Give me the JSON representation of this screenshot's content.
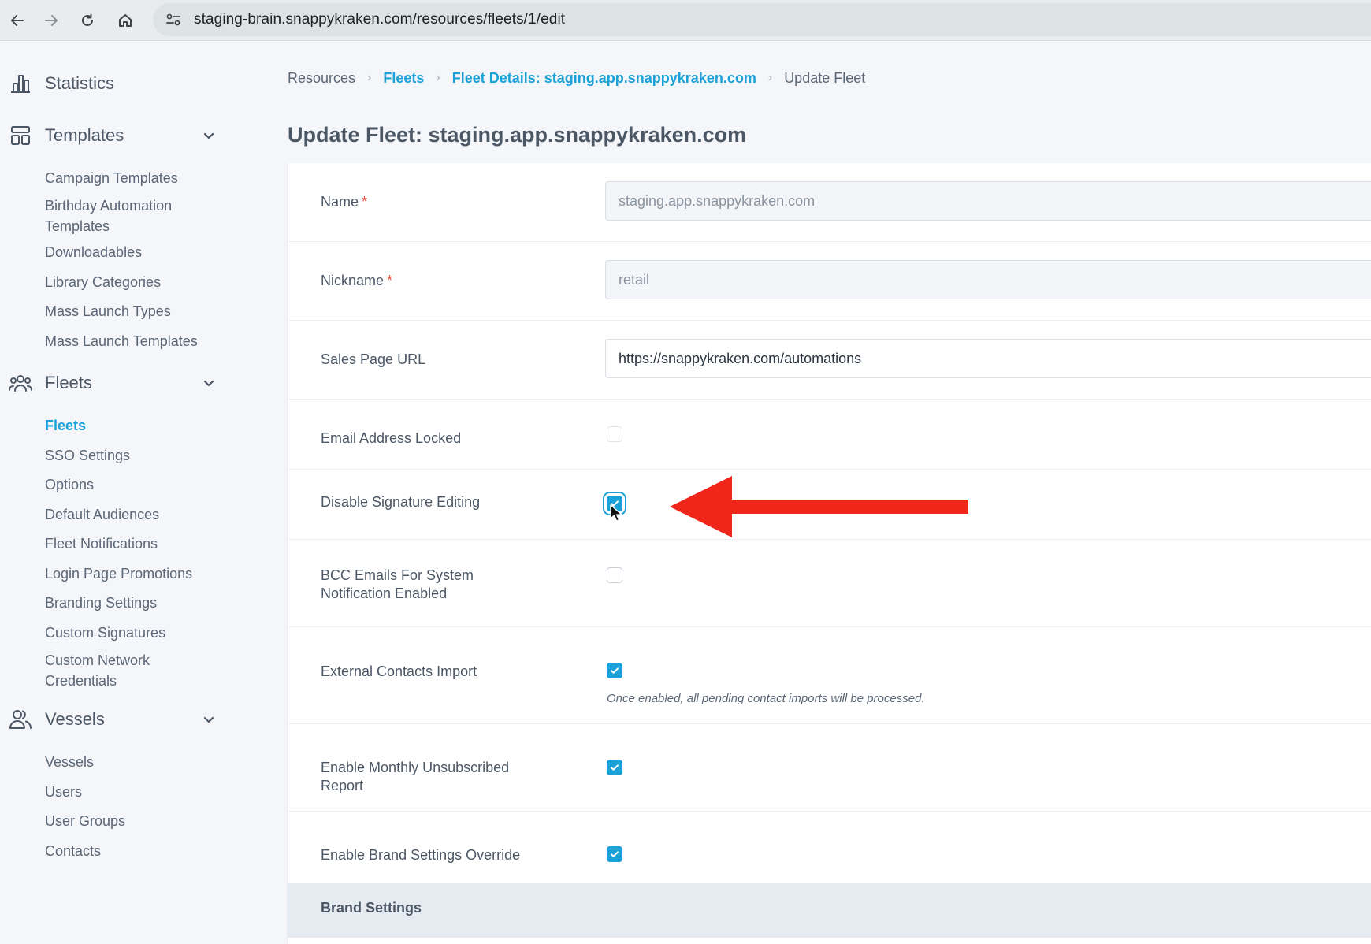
{
  "browser": {
    "url": "staging-brain.snappykraken.com/resources/fleets/1/edit"
  },
  "sidebar": {
    "statistics": "Statistics",
    "templates": {
      "label": "Templates",
      "items": [
        "Campaign Templates",
        "Birthday Automation Templates",
        "Downloadables",
        "Library Categories",
        "Mass Launch Types",
        "Mass Launch Templates"
      ]
    },
    "fleets": {
      "label": "Fleets",
      "items": [
        "Fleets",
        "SSO Settings",
        "Options",
        "Default Audiences",
        "Fleet Notifications",
        "Login Page Promotions",
        "Branding Settings",
        "Custom Signatures",
        "Custom Network Credentials"
      ],
      "active": "Fleets"
    },
    "vessels": {
      "label": "Vessels",
      "items": [
        "Vessels",
        "Users",
        "User Groups",
        "Contacts"
      ]
    }
  },
  "breadcrumb": [
    "Resources",
    "Fleets",
    "Fleet Details: staging.app.snappykraken.com",
    "Update Fleet"
  ],
  "page_title": "Update Fleet: staging.app.snappykraken.com",
  "form": {
    "name": {
      "label": "Name",
      "required": "*",
      "value": "staging.app.snappykraken.com"
    },
    "nickname": {
      "label": "Nickname",
      "required": "*",
      "value": "retail"
    },
    "sales_page_url": {
      "label": "Sales Page URL",
      "value": "https://snappykraken.com/automations"
    },
    "email_locked": {
      "label": "Email Address Locked",
      "checked": false
    },
    "disable_signature": {
      "label": "Disable Signature Editing",
      "checked": true
    },
    "bcc_emails": {
      "label": "BCC Emails For System Notification Enabled",
      "checked": false
    },
    "external_contacts": {
      "label": "External Contacts Import",
      "checked": true,
      "help": "Once enabled, all pending contact imports will be processed."
    },
    "monthly_unsub": {
      "label": "Enable Monthly Unsubscribed Report",
      "checked": true
    },
    "brand_override": {
      "label": "Enable Brand Settings Override",
      "checked": true
    }
  },
  "brand_settings_title": "Brand Settings",
  "colors": {
    "accent": "#1aa1d8",
    "arrow": "#f0261b",
    "required": "#e74c3c"
  }
}
